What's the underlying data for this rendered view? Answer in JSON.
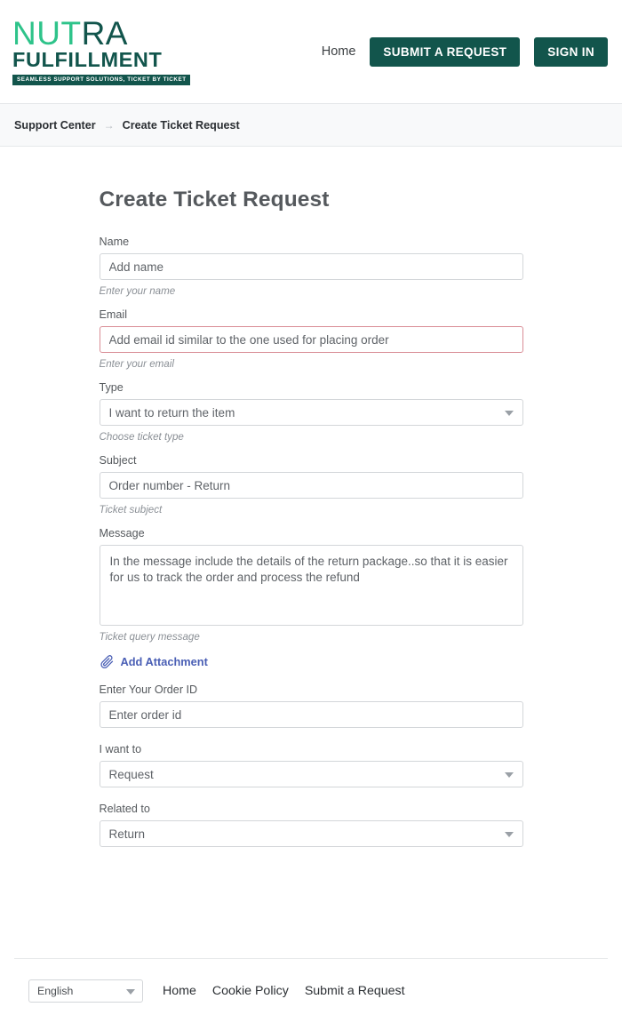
{
  "header": {
    "logo": {
      "line1_part1": "NU",
      "line1_part2": "T",
      "line1_part3": "RA",
      "line2": "FULFILLMENT",
      "tagline": "SEAMLESS SUPPORT SOLUTIONS, TICKET BY TICKET",
      "color_green": "#2ec38a",
      "color_dark": "#12554c"
    },
    "nav": {
      "home": "Home",
      "submit_request": "SUBMIT A REQUEST",
      "sign_in": "SIGN IN"
    }
  },
  "breadcrumb": {
    "root": "Support Center",
    "separator": "→",
    "current": "Create Ticket Request"
  },
  "form": {
    "title": "Create Ticket Request",
    "fields": {
      "name": {
        "label": "Name",
        "placeholder": "Add name",
        "value": "",
        "helper": "Enter your name"
      },
      "email": {
        "label": "Email",
        "placeholder": "Add email id similar to the one used for placing order",
        "value": "",
        "helper": "Enter your email",
        "error_border_color": "#d98d96"
      },
      "type": {
        "label": "Type",
        "selected": "I want to return the item",
        "helper": "Choose ticket type"
      },
      "subject": {
        "label": "Subject",
        "placeholder": "Order number - Return",
        "value": "",
        "helper": "Ticket subject"
      },
      "message": {
        "label": "Message",
        "placeholder": "In the message include the details of the return package..so that it is easier for us to track the order and process the refund",
        "value": "",
        "helper": "Ticket query message"
      },
      "attachment": {
        "label": "Add Attachment",
        "icon": "paperclip-icon",
        "color": "#4a5fb5"
      },
      "order_id": {
        "label": "Enter Your Order ID",
        "placeholder": "Enter order id",
        "value": ""
      },
      "i_want_to": {
        "label": "I want to",
        "selected": "Request"
      },
      "related_to": {
        "label": "Related to",
        "selected": "Return"
      }
    }
  },
  "footer": {
    "language": {
      "selected": "English"
    },
    "links": {
      "home": "Home",
      "cookie_policy": "Cookie Policy",
      "submit_request": "Submit a Request"
    }
  }
}
